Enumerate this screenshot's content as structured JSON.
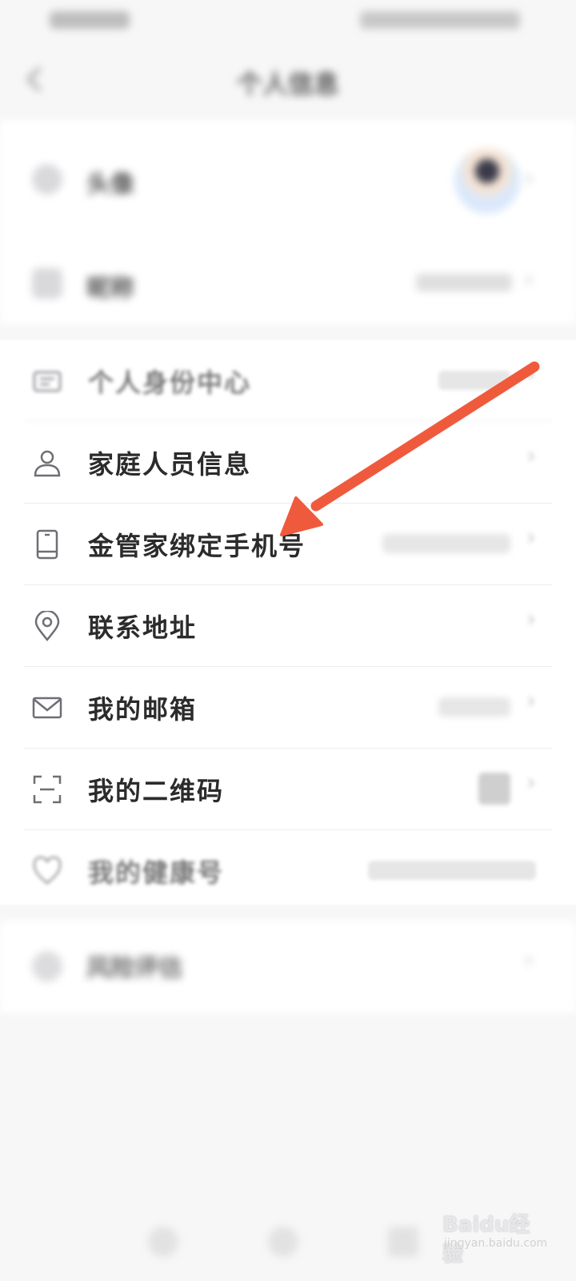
{
  "header": {
    "title": "个人信息"
  },
  "profile": {
    "avatar_label": "头像",
    "nickname_label": "昵称"
  },
  "menu": [
    {
      "label": "个人身份中心",
      "icon": "id-card-icon"
    },
    {
      "label": "家庭人员信息",
      "icon": "person-icon"
    },
    {
      "label": "金管家绑定手机号",
      "icon": "phone-icon"
    },
    {
      "label": "联系地址",
      "icon": "location-pin-icon"
    },
    {
      "label": "我的邮箱",
      "icon": "mail-icon"
    },
    {
      "label": "我的二维码",
      "icon": "qr-scan-icon"
    },
    {
      "label": "我的健康号",
      "icon": "heart-icon"
    }
  ],
  "bottom_item": {
    "label": "风险评估"
  },
  "annotation": {
    "arrow_color": "#f05a3c"
  },
  "watermark": {
    "main": "Baidu经验",
    "sub": "jingyan.baidu.com"
  }
}
